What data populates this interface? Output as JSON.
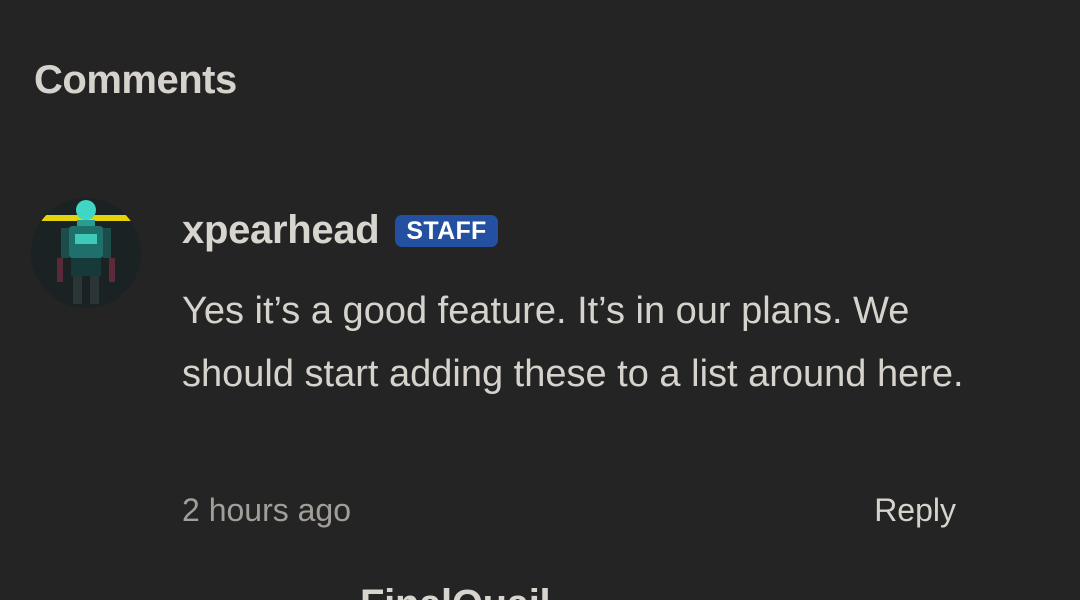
{
  "section": {
    "title": "Comments"
  },
  "comment": {
    "author": "xpearhead",
    "badge": "STAFF",
    "text": "Yes it’s a good feature. It’s in our plans. We should start adding these to a list around here.",
    "timestamp": "2 hours ago",
    "reply_label": "Reply"
  },
  "next_comment": {
    "author_partial": "FinalQuail"
  },
  "colors": {
    "background": "#242424",
    "badge": "#2350a0",
    "text": "#d6d3cd",
    "muted": "#a29f9a"
  }
}
